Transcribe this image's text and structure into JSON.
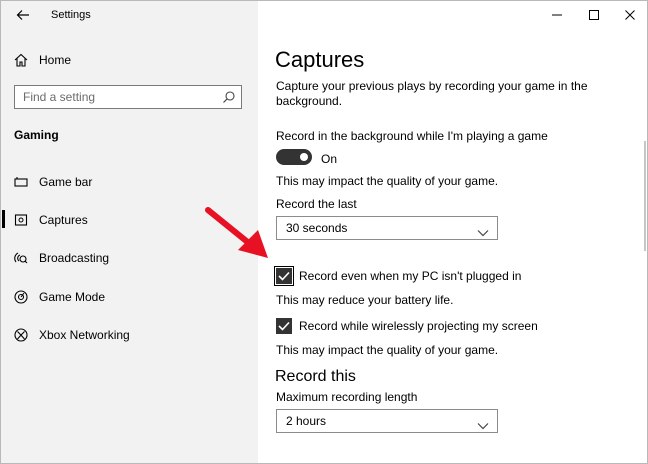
{
  "window": {
    "title": "Settings",
    "accent_color": "#e81123"
  },
  "sidebar": {
    "home_label": "Home",
    "search_placeholder": "Find a setting",
    "section_label": "Gaming",
    "items": [
      {
        "label": "Game bar",
        "icon": "game-bar-icon"
      },
      {
        "label": "Captures",
        "icon": "captures-icon",
        "selected": true
      },
      {
        "label": "Broadcasting",
        "icon": "broadcasting-icon"
      },
      {
        "label": "Game Mode",
        "icon": "game-mode-icon"
      },
      {
        "label": "Xbox Networking",
        "icon": "xbox-icon"
      }
    ]
  },
  "main": {
    "title": "Captures",
    "description": "Capture your previous plays by recording your game in the background.",
    "record_background_label": "Record in the background while I'm playing a game",
    "toggle_state": "On",
    "record_background_note": "This may impact the quality of your game.",
    "record_last_label": "Record the last",
    "record_last_value": "30 seconds",
    "plugged_in_label": "Record even when my PC isn't plugged in",
    "plugged_in_note": "This may reduce your battery life.",
    "wireless_label": "Record while wirelessly projecting my screen",
    "wireless_note": "This may impact the quality of your game.",
    "record_this_heading": "Record this",
    "max_length_label": "Maximum recording length",
    "max_length_value": "2 hours"
  }
}
